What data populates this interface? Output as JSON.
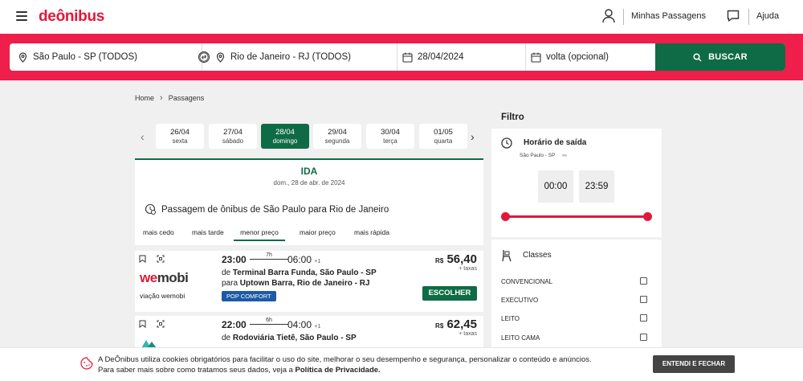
{
  "nav": {
    "logo": "deônibus",
    "my_trips": "Minhas Passagens",
    "help": "Ajuda"
  },
  "search": {
    "origin": "São Paulo - SP (TODOS)",
    "destination": "Rio de Janeiro - RJ (TODOS)",
    "date": "28/04/2024",
    "return": "volta (opcional)",
    "button": "BUSCAR"
  },
  "breadcrumb": {
    "home": "Home",
    "current": "Passagens"
  },
  "dates": [
    {
      "day": "26/04",
      "weekday": "sexta",
      "active": false
    },
    {
      "day": "27/04",
      "weekday": "sábado",
      "active": false
    },
    {
      "day": "28/04",
      "weekday": "domingo",
      "active": true
    },
    {
      "day": "29/04",
      "weekday": "segunda",
      "active": false
    },
    {
      "day": "30/04",
      "weekday": "terça",
      "active": false
    },
    {
      "day": "01/05",
      "weekday": "quarta",
      "active": false
    }
  ],
  "results": {
    "direction": "IDA",
    "date_long": "dom., 28 de abr. de 2024",
    "title": "Passagem de ônibus de São Paulo para Rio de Janeiro",
    "sorts": [
      "mais cedo",
      "mais tarde",
      "menor preço",
      "maior preço",
      "mais rápida"
    ],
    "active_sort": "menor preço"
  },
  "trips": [
    {
      "brand_a": "we",
      "brand_b": "mobi",
      "operator": "viação wemobi",
      "departure": "23:00",
      "duration": "7h",
      "arrival": "06:00",
      "day_offset": "+1",
      "from_prefix": "de",
      "from": "Terminal Barra Funda, São Paulo - SP",
      "to_prefix": "para",
      "to": "Uptown Barra, Rio de Janeiro - RJ",
      "class": "POP COMFORT",
      "currency": "R$",
      "price": "56,40",
      "tax": "+ taxas",
      "button": "ESCOLHER"
    },
    {
      "brand_a": "",
      "brand_b": "",
      "operator": "",
      "departure": "22:00",
      "duration": "6h",
      "arrival": "04:00",
      "day_offset": "+1",
      "from_prefix": "de",
      "from": "Rodoviária Tietê, São Paulo - SP",
      "currency": "R$",
      "price": "62,45",
      "tax": "+ taxas"
    }
  ],
  "filter": {
    "title": "Filtro",
    "departure_title": "Horário de saída",
    "departure_city": "São Paulo - SP",
    "time_from": "00:00",
    "time_to": "23:59",
    "classes_title": "Classes",
    "classes": [
      "CONVENCIONAL",
      "EXECUTIVO",
      "LEITO",
      "LEITO CAMA"
    ]
  },
  "cookie": {
    "line1": "A DeÔnibus utiliza cookies obrigatórios para facilitar o uso do site, melhorar o seu desempenho e segurança, personalizar o conteúdo e anúncios.",
    "line2": "Para saber mais sobre como tratamos seus dados, veja a",
    "link": "Política de Privacidade.",
    "button": "ENTENDI E FECHAR"
  },
  "colors": {
    "brand_red": "#ef1e4a",
    "accent_green": "#0f6b45",
    "badge_blue": "#1c5aa6"
  }
}
